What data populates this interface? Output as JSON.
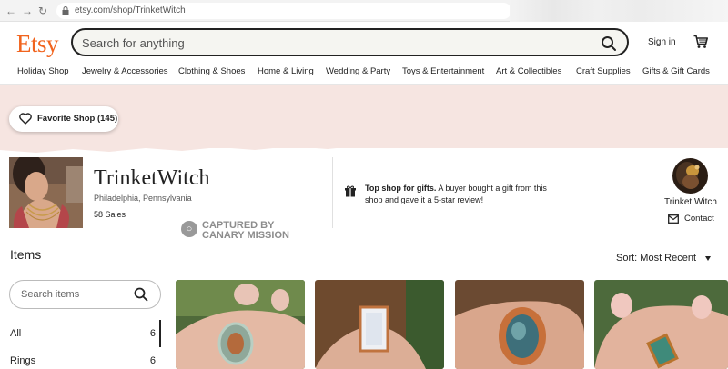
{
  "browser": {
    "url": "etsy.com/shop/TrinketWitch"
  },
  "header": {
    "logo": "Etsy",
    "search_placeholder": "Search for anything",
    "sign_in": "Sign in"
  },
  "categories": [
    "Holiday Shop",
    "Jewelry & Accessories",
    "Clothing & Shoes",
    "Home & Living",
    "Wedding & Party",
    "Toys & Entertainment",
    "Art & Collectibles",
    "Craft Supplies",
    "Gifts & Gift Cards"
  ],
  "banner": {
    "favorite_label": "Favorite Shop (145)"
  },
  "shop": {
    "name": "TrinketWitch",
    "location": "Philadelphia, Pennsylvania",
    "sales": "58 Sales",
    "gift_strong": "Top shop for gifts.",
    "gift_rest": "A buyer bought a gift from this shop and gave it a 5-star review!",
    "owner_name": "Trinket Witch",
    "contact_label": "Contact"
  },
  "watermark": {
    "line1": "CAPTURED BY",
    "line2": "CANARY MISSION"
  },
  "items": {
    "title": "Items",
    "sort_label": "Sort: Most Recent",
    "search_placeholder": "Search items",
    "sections": [
      {
        "label": "All",
        "count": "6"
      },
      {
        "label": "Rings",
        "count": "6"
      }
    ]
  },
  "colors": {
    "brand": "#f1641e",
    "banner": "#f6e5e1"
  }
}
